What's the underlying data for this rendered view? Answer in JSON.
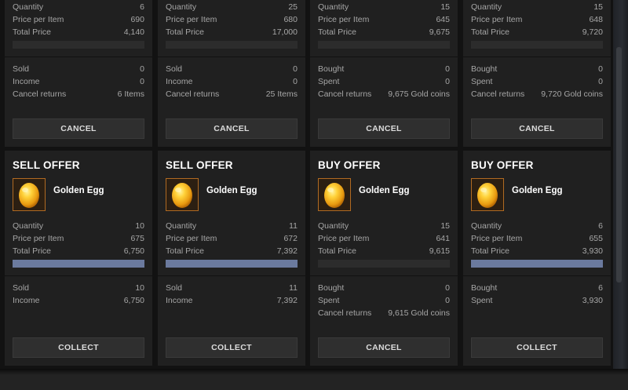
{
  "offers_top": [
    {
      "rows": [
        [
          "Quantity",
          "6"
        ],
        [
          "Price per Item",
          "690"
        ],
        [
          "Total Price",
          "4,140"
        ]
      ],
      "fill": 0,
      "rows2": [
        [
          "Sold",
          "0"
        ],
        [
          "Income",
          "0"
        ],
        [
          "Cancel returns",
          "6 Items"
        ]
      ],
      "button": "CANCEL"
    },
    {
      "rows": [
        [
          "Quantity",
          "25"
        ],
        [
          "Price per Item",
          "680"
        ],
        [
          "Total Price",
          "17,000"
        ]
      ],
      "fill": 0,
      "rows2": [
        [
          "Sold",
          "0"
        ],
        [
          "Income",
          "0"
        ],
        [
          "Cancel returns",
          "25 Items"
        ]
      ],
      "button": "CANCEL"
    },
    {
      "rows": [
        [
          "Quantity",
          "15"
        ],
        [
          "Price per Item",
          "645"
        ],
        [
          "Total Price",
          "9,675"
        ]
      ],
      "fill": 0,
      "rows2": [
        [
          "Bought",
          "0"
        ],
        [
          "Spent",
          "0"
        ],
        [
          "Cancel returns",
          "9,675 Gold coins"
        ]
      ],
      "button": "CANCEL"
    },
    {
      "rows": [
        [
          "Quantity",
          "15"
        ],
        [
          "Price per Item",
          "648"
        ],
        [
          "Total Price",
          "9,720"
        ]
      ],
      "fill": 0,
      "rows2": [
        [
          "Bought",
          "0"
        ],
        [
          "Spent",
          "0"
        ],
        [
          "Cancel returns",
          "9,720 Gold coins"
        ]
      ],
      "button": "CANCEL"
    }
  ],
  "offers_bottom": [
    {
      "title": "SELL OFFER",
      "item": "Golden Egg",
      "icon": "golden-egg-icon",
      "rows": [
        [
          "Quantity",
          "10"
        ],
        [
          "Price per Item",
          "675"
        ],
        [
          "Total Price",
          "6,750"
        ]
      ],
      "fill": 1,
      "rows2": [
        [
          "Sold",
          "10"
        ],
        [
          "Income",
          "6,750"
        ]
      ],
      "button": "COLLECT"
    },
    {
      "title": "SELL OFFER",
      "item": "Golden Egg",
      "icon": "golden-egg-icon",
      "rows": [
        [
          "Quantity",
          "11"
        ],
        [
          "Price per Item",
          "672"
        ],
        [
          "Total Price",
          "7,392"
        ]
      ],
      "fill": 1,
      "rows2": [
        [
          "Sold",
          "11"
        ],
        [
          "Income",
          "7,392"
        ]
      ],
      "button": "COLLECT"
    },
    {
      "title": "BUY OFFER",
      "item": "Golden Egg",
      "icon": "golden-egg-icon",
      "rows": [
        [
          "Quantity",
          "15"
        ],
        [
          "Price per Item",
          "641"
        ],
        [
          "Total Price",
          "9,615"
        ]
      ],
      "fill": 0,
      "rows2": [
        [
          "Bought",
          "0"
        ],
        [
          "Spent",
          "0"
        ],
        [
          "Cancel returns",
          "9,615 Gold coins"
        ]
      ],
      "button": "CANCEL"
    },
    {
      "title": "BUY OFFER",
      "item": "Golden Egg",
      "icon": "golden-egg-icon",
      "rows": [
        [
          "Quantity",
          "6"
        ],
        [
          "Price per Item",
          "655"
        ],
        [
          "Total Price",
          "3,930"
        ]
      ],
      "fill": 1,
      "rows2": [
        [
          "Bought",
          "6"
        ],
        [
          "Spent",
          "3,930"
        ]
      ],
      "button": "COLLECT"
    }
  ],
  "colors": {
    "progress_fill": "#6b7a9e",
    "egg": "#f2b21c",
    "icon_border": "#b06a22"
  }
}
